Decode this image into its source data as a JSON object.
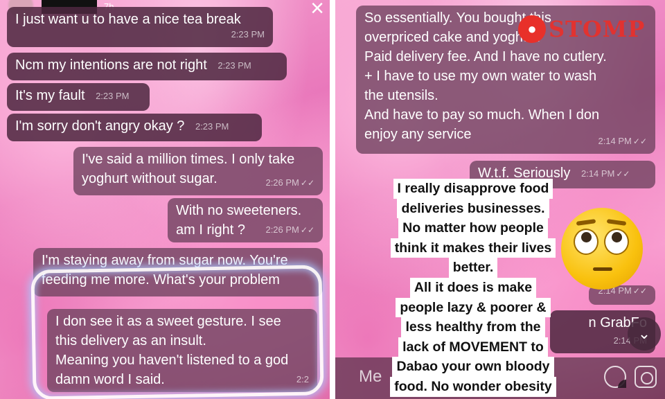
{
  "left": {
    "story_time": "7h",
    "close_symbol": "×",
    "messages": [
      {
        "text": "I just want u to have a nice tea break",
        "time": "2:23 PM",
        "checks": ""
      },
      {
        "text": "Ncm my intentions are not right",
        "time": "2:23 PM",
        "checks": ""
      },
      {
        "text": "It's my fault",
        "time": "2:23 PM",
        "checks": ""
      },
      {
        "text": "I'm sorry don't angry okay ?",
        "time": "2:23 PM",
        "checks": ""
      },
      {
        "text": "I've said a million times. I only take\nyoghurt without sugar.",
        "time": "2:26 PM",
        "checks": "✓✓"
      },
      {
        "text": "With no sweeteners.\nam I right ?",
        "time": "2:26 PM",
        "checks": "✓✓"
      },
      {
        "text": "I'm staying away from sugar now. You're\nfeeding me more. What's your problem",
        "time": "",
        "checks": ""
      },
      {
        "text": "I don see it as a sweet gesture. I see\nthis delivery as an insult.\nMeaning you haven't listened to a god\ndamn word I said.",
        "time": "2:2",
        "checks": ""
      }
    ]
  },
  "right": {
    "logo_text": "STOMP",
    "messages": [
      {
        "text": "So essentially. You bought this\noverpriced cake and yoghurt\nPaid delivery fee. And I have no cutlery.\n+ I have to use my own water to wash\nthe utensils.\nAnd have to pay so much. When I don\nenjoy any service",
        "time": "2:14 PM",
        "checks": "✓✓"
      },
      {
        "text": "W.t.f. Seriously",
        "time": "2:14 PM",
        "checks": "✓✓"
      },
      {
        "text": "",
        "time": "2:14 PM",
        "checks": "✓✓"
      },
      {
        "text": "n GrabFo",
        "time": "2:14 PM",
        "checks": ""
      }
    ],
    "story_lines": [
      "I really disapprove food",
      "deliveries businesses.",
      "No matter how people",
      "think it makes their lives",
      "better.",
      "All it does is make",
      "people lazy & poorer &",
      "less healthy from the",
      "lack of MOVEMENT to",
      "Dabao your own bloody",
      "food. No wonder obesity"
    ],
    "input_placeholder": "Me",
    "scroll_symbol": "⌄"
  }
}
